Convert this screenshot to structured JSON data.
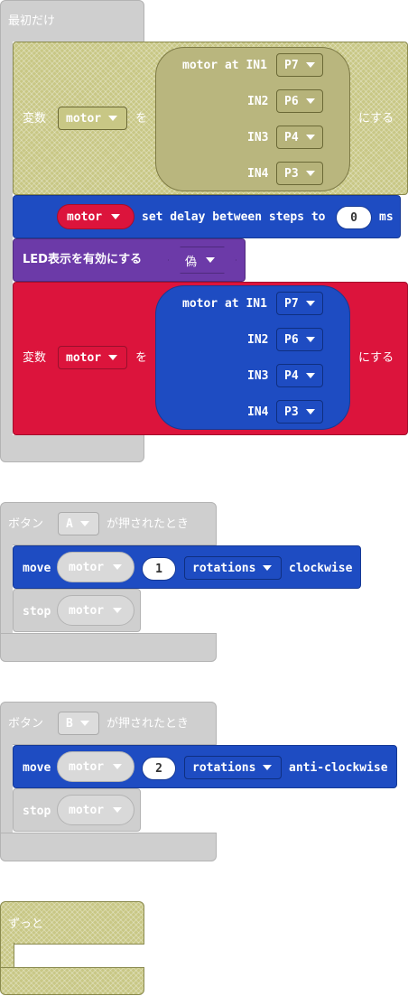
{
  "on_start": {
    "title": "最初だけ",
    "set_var1": {
      "prefix": "変数",
      "var": "motor",
      "mid": "を",
      "suffix": "にする",
      "motor_label": "motor at IN1",
      "pins": [
        {
          "label": "",
          "value": "P7"
        },
        {
          "label": "IN2",
          "value": "P6"
        },
        {
          "label": "IN3",
          "value": "P4"
        },
        {
          "label": "IN4",
          "value": "P3"
        }
      ]
    },
    "set_delay": {
      "var": "motor",
      "text": "set delay between steps to",
      "value": "0",
      "unit": "ms"
    },
    "led": {
      "text": "LED表示を有効にする",
      "value": "偽"
    },
    "set_var2": {
      "prefix": "変数",
      "var": "motor",
      "mid": "を",
      "suffix": "にする",
      "motor_label": "motor at IN1",
      "pins": [
        {
          "label": "",
          "value": "P7"
        },
        {
          "label": "IN2",
          "value": "P6"
        },
        {
          "label": "IN3",
          "value": "P4"
        },
        {
          "label": "IN4",
          "value": "P3"
        }
      ]
    }
  },
  "button_a": {
    "prefix": "ボタン",
    "button": "A",
    "suffix": "が押されたとき",
    "move": {
      "label": "move",
      "var": "motor",
      "count": "1",
      "unit": "rotations",
      "direction": "clockwise"
    },
    "stop": {
      "label": "stop",
      "var": "motor"
    }
  },
  "button_b": {
    "prefix": "ボタン",
    "button": "B",
    "suffix": "が押されたとき",
    "move": {
      "label": "move",
      "var": "motor",
      "count": "2",
      "unit": "rotations",
      "direction": "anti-clockwise"
    },
    "stop": {
      "label": "stop",
      "var": "motor"
    }
  },
  "forever": {
    "title": "ずっと"
  },
  "colors": {
    "motor_blue": "#1e4cc2",
    "variables_red": "#dc143c",
    "led_purple": "#6c3aa8",
    "events_gray": "#cfcfcf",
    "disabled_olive": "#c8c785"
  }
}
